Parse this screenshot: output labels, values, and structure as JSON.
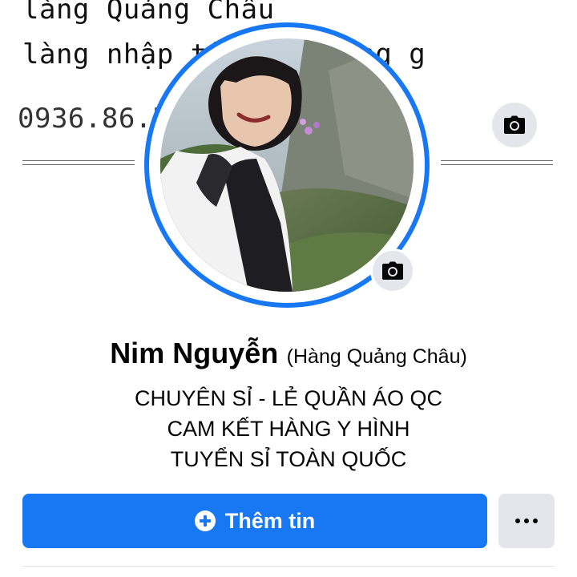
{
  "cover": {
    "line1": "làng Quảng Châu",
    "line2": "làng nhập tổ          qua trung g",
    "line3": "0936.86.5                   /by_ n_"
  },
  "profile": {
    "name": "Nim Nguyễn",
    "alternate_name": "(Hàng Quảng Châu)",
    "bio": [
      "CHUYÊN SỈ - LẺ QUẦN ÁO QC",
      "CAM KẾT HÀNG Y HÌNH",
      "TUYỂN SỈ TOÀN QUỐC"
    ]
  },
  "actions": {
    "add_info_label": "Thêm tin"
  },
  "icons": {
    "cover_camera": "camera-icon",
    "avatar_camera": "camera-icon",
    "add_info": "plus-circle-icon",
    "more": "ellipsis-icon"
  },
  "colors": {
    "accent": "#1877f2",
    "secondary_button": "#e4e6eb",
    "text": "#050505"
  }
}
